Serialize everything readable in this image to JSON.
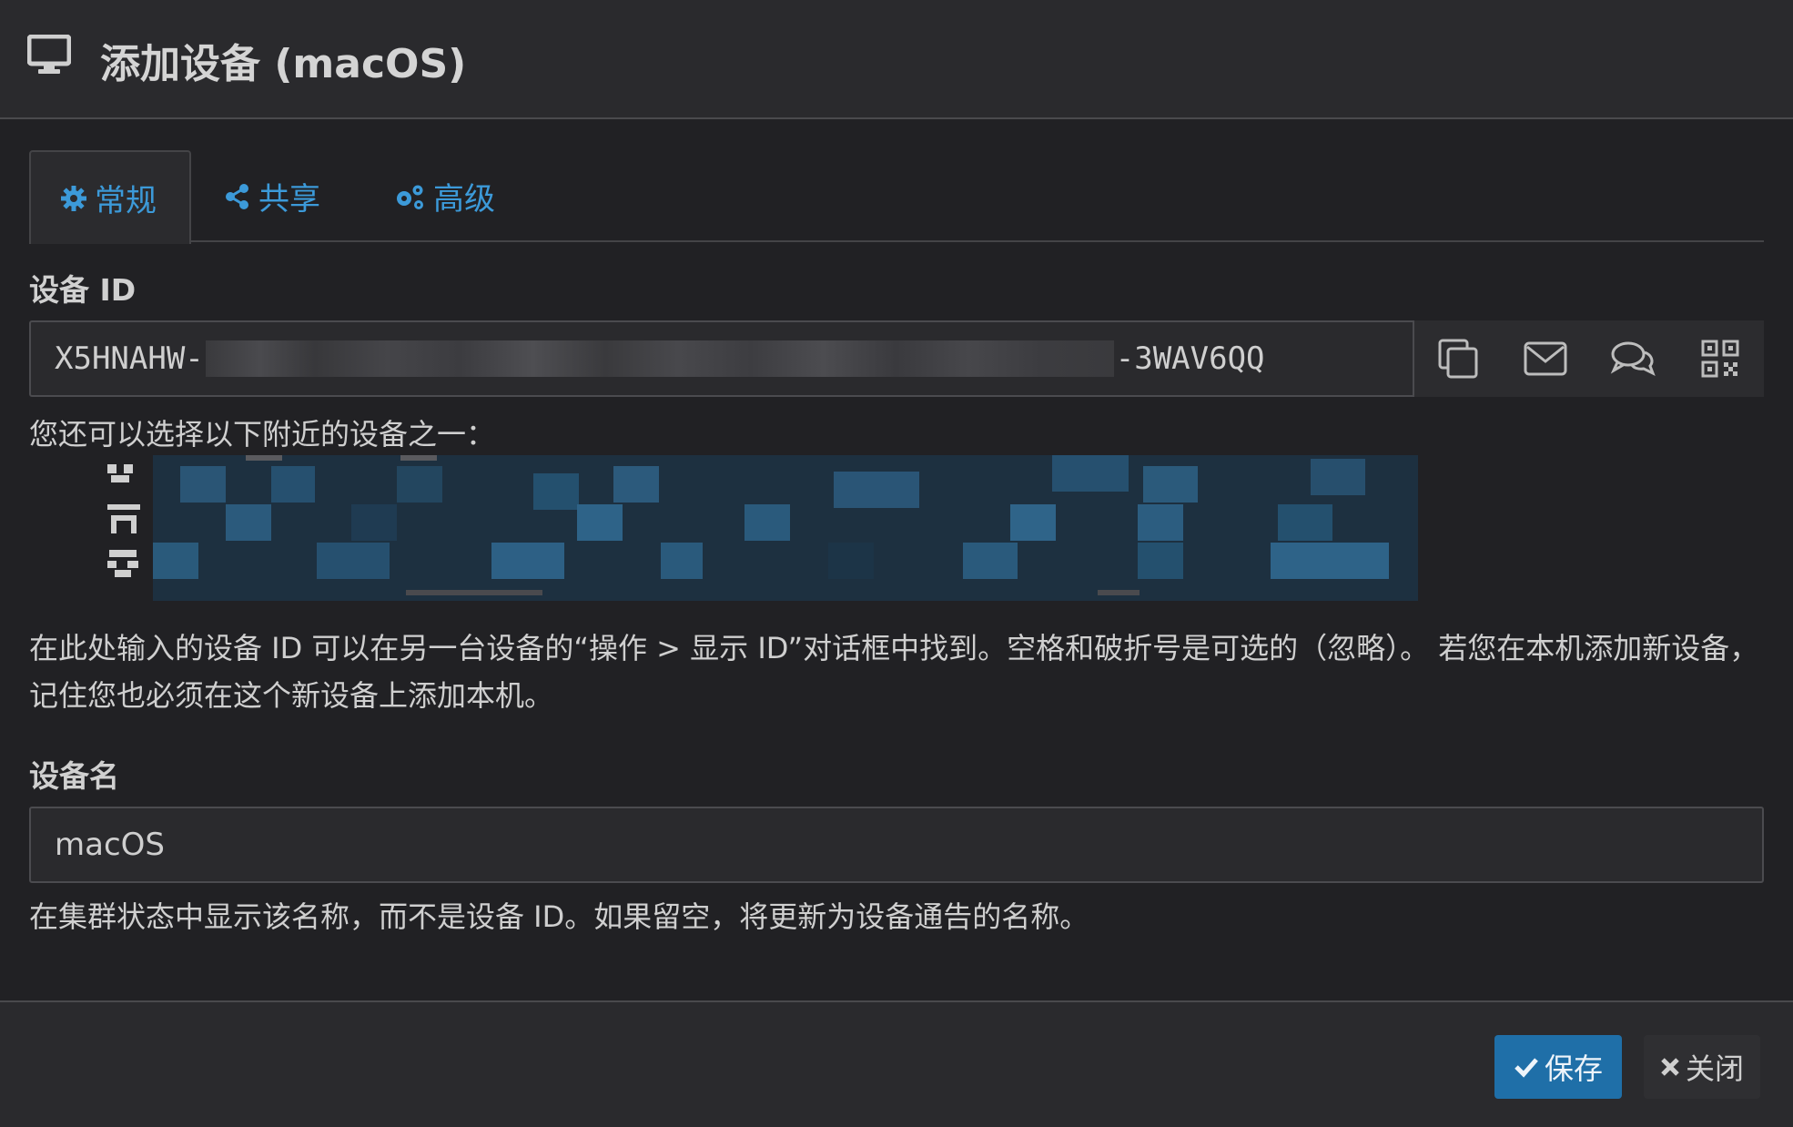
{
  "header": {
    "title": "添加设备 (macOS)",
    "icon": "monitor-icon"
  },
  "tabs": [
    {
      "label": "常规",
      "icon": "gear-icon",
      "active": true
    },
    {
      "label": "共享",
      "icon": "share-icon",
      "active": false
    },
    {
      "label": "高级",
      "icon": "cogs-icon",
      "active": false
    }
  ],
  "device_id": {
    "label": "设备 ID",
    "value_prefix": "X5HNAHW-",
    "value_suffix": "-3WAV6QQ",
    "actions": [
      "copy-icon",
      "envelope-icon",
      "comments-icon",
      "qrcode-icon"
    ]
  },
  "nearby": {
    "text": "您还可以选择以下附近的设备之一："
  },
  "help_id": "在此处输入的设备 ID 可以在另一台设备的“操作 > 显示 ID”对话框中找到。空格和破折号是可选的（忽略）。 若您在本机添加新设备，记住您也必须在这个新设备上添加本机。",
  "device_name": {
    "label": "设备名",
    "value": "macOS"
  },
  "help_name": "在集群状态中显示该名称，而不是设备 ID。如果留空，将更新为设备通告的名称。",
  "footer": {
    "save_label": "保存",
    "close_label": "关闭"
  },
  "colors": {
    "accent": "#3c9ad9",
    "save_bg": "#1f6fa8",
    "background": "#212124"
  }
}
